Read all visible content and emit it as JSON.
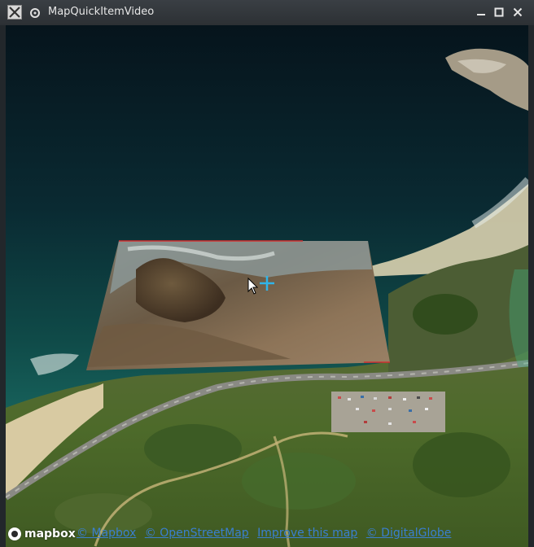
{
  "window": {
    "title": "MapQuickItemVideo",
    "icons": {
      "app": "x-app-icon",
      "pin": "pin-icon",
      "minimize": "minimize-icon",
      "maximize": "maximize-icon",
      "close": "close-icon"
    }
  },
  "map": {
    "overlay": "video-frame-overlay",
    "cursor": "mouse-pointer-icon",
    "crosshair": "crosshair-icon"
  },
  "attribution": {
    "logo_text": "mapbox",
    "links": [
      "© Mapbox",
      "© OpenStreetMap",
      "Improve this map",
      "© DigitalGlobe"
    ],
    "link_color": "#3a7fcf"
  }
}
